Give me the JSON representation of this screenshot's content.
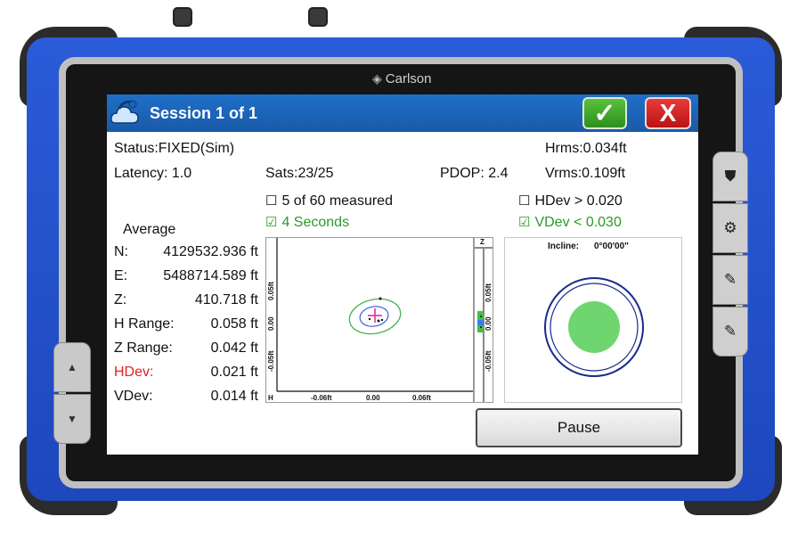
{
  "device": {
    "brand": "Carlson"
  },
  "header": {
    "title": "Session 1 of 1",
    "ok_label": "✓",
    "cancel_label": "X"
  },
  "status": {
    "status": "Status:FIXED(Sim)",
    "hrms": "Hrms:0.034ft",
    "latency": "Latency: 1.0",
    "sats": "Sats:23/25",
    "pdop": "PDOP: 2.4",
    "vrms": "Vrms:0.109ft"
  },
  "criteria": {
    "measured": "5 of 60 measured",
    "seconds": "4 Seconds",
    "hdev_limit": "HDev > 0.020",
    "vdev_limit": "VDev < 0.030"
  },
  "average": {
    "heading": "Average",
    "rows": [
      {
        "label": "N:",
        "value": "4129532.936 ft"
      },
      {
        "label": "E:",
        "value": "5488714.589 ft"
      },
      {
        "label": "Z:",
        "value": "410.718 ft"
      },
      {
        "label": "H Range:",
        "value": "0.058 ft"
      },
      {
        "label": "Z Range:",
        "value": "0.042 ft"
      },
      {
        "label": "HDev:",
        "value": "0.021 ft"
      },
      {
        "label": "VDev:",
        "value": "0.014 ft"
      }
    ]
  },
  "plot": {
    "h_label": "H",
    "z_label": "Z",
    "x_ticks": [
      "-0.06ft",
      "0.00",
      "0.06ft"
    ],
    "y_ticks": [
      "0.05ft",
      "0.00",
      "-0.05ft"
    ],
    "z_ticks": [
      "0.05ft",
      "0.00",
      "-0.05ft"
    ]
  },
  "incline": {
    "label": "Incline:",
    "value": "0°00'00\""
  },
  "actions": {
    "pause_label": "Pause"
  },
  "colors": {
    "titlebar": "#1f6fc8",
    "ok": "#3fa82a",
    "cancel": "#d42020",
    "bubble": "#6fd66f",
    "ellipse": "#4caf50"
  }
}
